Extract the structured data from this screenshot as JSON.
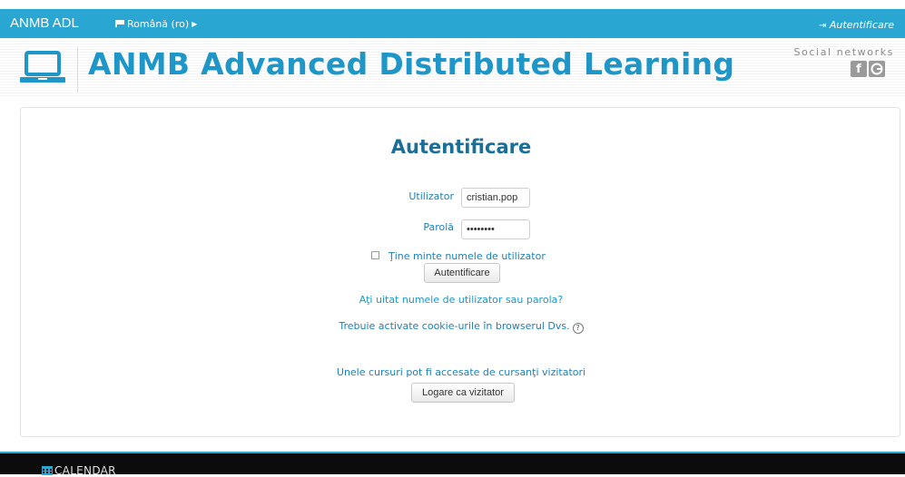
{
  "topbar": {
    "brand": "ANMB ADL",
    "language": "Română (ro)",
    "login_link": "Autentificare"
  },
  "header": {
    "site_title": "ANMB Advanced Distributed Learning",
    "social_label": "Social networks",
    "social_icons": [
      "facebook-icon",
      "google-plus-icon"
    ]
  },
  "login": {
    "title": "Autentificare",
    "username_label": "Utilizator",
    "username_value": "cristian.pop",
    "password_label": "Parolă",
    "password_value": "••••••••",
    "remember_label": "Ţine minte numele de utilizator",
    "remember_checked": false,
    "submit_label": "Autentificare",
    "forgot_link": "Aţi uitat numele de utilizator sau parola?",
    "cookies_text": "Trebuie activate cookie-urile în browserul Dvs.",
    "guest_text": "Unele cursuri pot fi accesate de cursanţi vizitatori",
    "guest_button": "Logare ca vizitator"
  },
  "footer": {
    "calendar_label": "CALENDAR"
  },
  "colors": {
    "accent": "#29a6d2",
    "title": "#1e96c8",
    "link": "#1e80b8",
    "footer_bg": "#0c0c0c"
  }
}
